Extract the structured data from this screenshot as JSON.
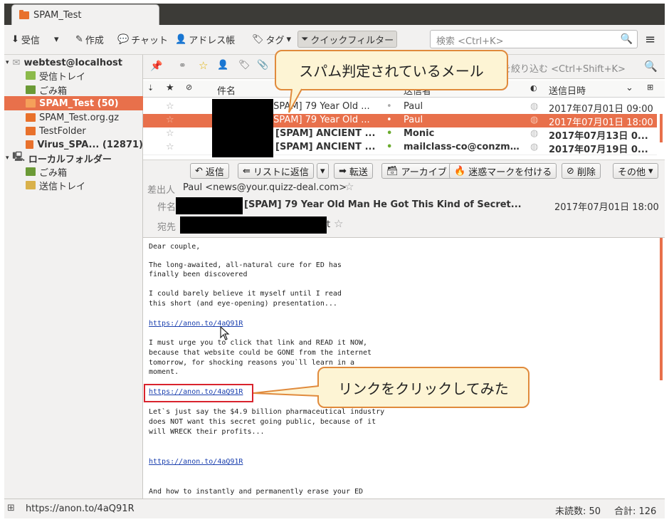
{
  "window": {
    "tab_title": "SPAM_Test"
  },
  "toolbar": {
    "get_mail": "受信",
    "write": "作成",
    "chat": "チャット",
    "address_book": "アドレス帳",
    "tag": "タグ",
    "quick_filter": "クイックフィルター",
    "search_placeholder": "検索 <Ctrl+K>"
  },
  "sidebar": {
    "account": "webtest@localhost",
    "items": [
      {
        "label": "受信トレイ"
      },
      {
        "label": "ごみ箱"
      },
      {
        "label": "SPAM_Test (50)"
      },
      {
        "label": "SPAM_Test.org.gz"
      },
      {
        "label": "TestFolder"
      },
      {
        "label": "Virus_SPA... (12871)"
      }
    ],
    "local": "ローカルフォルダー",
    "local_items": [
      {
        "label": "ごみ箱"
      },
      {
        "label": "送信トレイ"
      }
    ]
  },
  "filter": {
    "placeholder": "を絞り込む <Ctrl+Shift+K>"
  },
  "columns": {
    "subject": "件名",
    "sender": "送信者",
    "date": "送信日時"
  },
  "messages": [
    {
      "subject": "[SPAM] 79 Year Old ...",
      "sender": "Paul",
      "date": "2017年07月01日 09:00"
    },
    {
      "subject": "[SPAM] 79 Year Old ...",
      "sender": "Paul",
      "date": "2017年07月01日 18:00"
    },
    {
      "subject": "[SPAM] ANCIENT ...",
      "sender": "Monic",
      "date": "2017年07月13日 0..."
    },
    {
      "subject": "[SPAM] ANCIENT ...",
      "sender": "mailclass-co@conzme...",
      "date": "2017年07月19日 0..."
    }
  ],
  "msg_toolbar": {
    "reply": "返信",
    "reply_list": "リストに返信",
    "forward": "転送",
    "archive": "アーカイブ",
    "junk": "迷惑マークを付ける",
    "delete": "削除",
    "other": "その他"
  },
  "header": {
    "from_label": "差出人",
    "from": "Paul <news@your.quizz-deal.com>",
    "subject_label": "件名",
    "subject": "[SPAM] 79 Year Old Man He Got This Kind of Secret...",
    "date": "2017年07月01日 18:00",
    "to_label": "宛先",
    "to_tail": "t"
  },
  "body": {
    "l1": "Dear couple,",
    "l2": "The long-awaited, all-natural cure for ED has",
    "l3": "finally been discovered",
    "l4": "I could barely believe it myself until I read",
    "l5": "this short (and eye-opening) presentation...",
    "link1": "https://anon.to/4aQ91R",
    "l6": "I must urge you to click that link and READ it NOW,",
    "l7": "because that website could be GONE from the internet",
    "l8": "tomorrow, for shocking reasons you`ll learn in a",
    "l9": "moment.",
    "link2": "https://anon.to/4aQ91R",
    "l10": "Let`s just say the $4.9 billion pharmaceutical industry",
    "l11": "does NOT want this secret going public, because of it",
    "l12": "will WRECK their profits...",
    "link3": "https://anon.to/4aQ91R",
    "l13": "And how to instantly and permanently erase your ED"
  },
  "callouts": {
    "spam": "スパム判定されているメール",
    "link": "リンクをクリックしてみた"
  },
  "status": {
    "url": "https://anon.to/4aQ91R",
    "unread": "未読数: 50",
    "total": "合計: 126"
  },
  "colors": {
    "accent": "#e8704b",
    "callout_border": "#e08a3c",
    "link": "#1a3fae"
  }
}
